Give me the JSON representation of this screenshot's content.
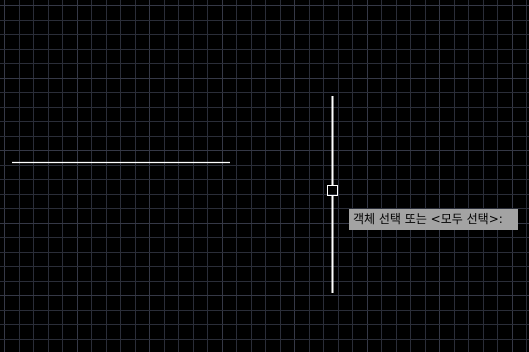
{
  "canvas": {
    "background_color": "#000000",
    "grid_color": "#2a2d38",
    "grid_major_color": "#353846",
    "line_color": "#ffffff"
  },
  "cursor": {
    "pickbox_icon": "pickbox-square",
    "crosshair_icon": "crosshair-line"
  },
  "prompt": {
    "text": "객체 선택 또는 <모두 선택>:",
    "background_color": "#a3a3a3",
    "text_color": "#000000"
  }
}
